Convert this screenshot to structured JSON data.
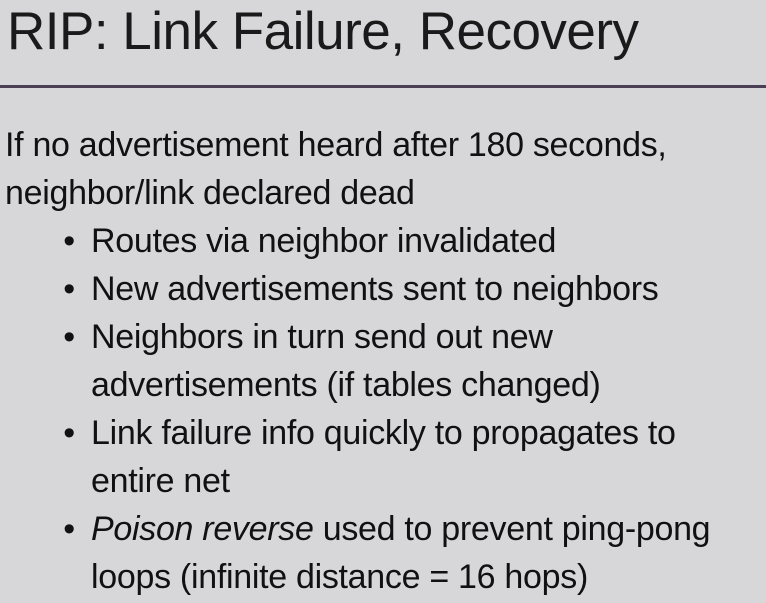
{
  "slide": {
    "title": "RIP: Link Failure, Recovery",
    "intro_line1": "If no advertisement heard after 180 seconds,",
    "intro_line2": "neighbor/link declared dead",
    "bullet_glyph": "•",
    "bullets": [
      {
        "text": "Routes via neighbor invalidated"
      },
      {
        "text": "New advertisements sent to neighbors"
      },
      {
        "line1": "Neighbors in turn send out new",
        "line2": "advertisements (if tables changed)"
      },
      {
        "line1": "Link failure info quickly to propagates to",
        "line2": "entire net"
      },
      {
        "emphasis": "Poison reverse",
        "line1_rest": " used to prevent ping-pong",
        "line2": "loops (infinite distance = 16 hops)"
      }
    ]
  },
  "colors": {
    "background": "#d7d7da",
    "text": "#111111",
    "rule": "#4a3f55"
  }
}
